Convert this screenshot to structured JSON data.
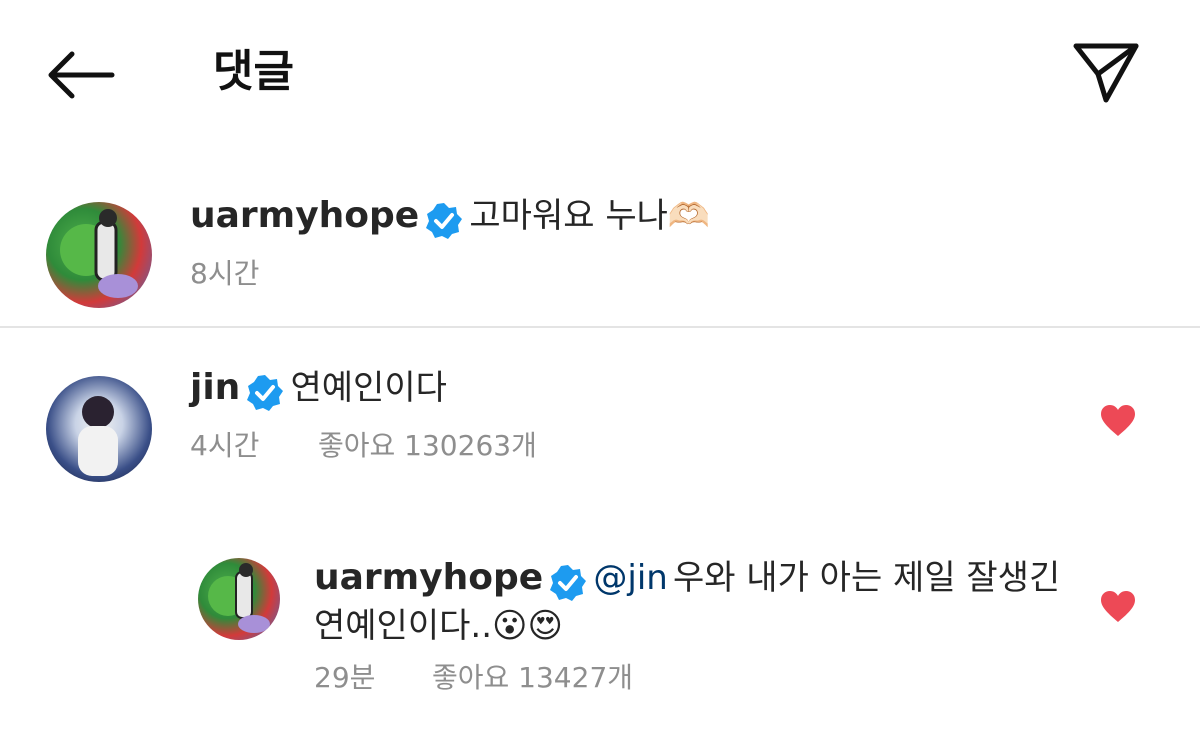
{
  "header": {
    "title": "댓글"
  },
  "comments": [
    {
      "username": "uarmyhope",
      "text": "고마워요 누나🫶🏻",
      "time": "8시간"
    },
    {
      "username": "jin",
      "text": "연예인이다",
      "time": "4시간",
      "likes": "좋아요 130263개",
      "liked": true,
      "reply": {
        "username": "uarmyhope",
        "mention": "@jin",
        "text_line1": "우와 내가 아는 제일 잘생긴",
        "text_line2": "연예인이다..",
        "emojis": "😮😍",
        "time": "29분",
        "likes": "좋아요 13427개",
        "liked": true
      }
    }
  ],
  "colors": {
    "verified": "#1d9bf0",
    "heart": "#ed4956",
    "mention": "#00376b",
    "meta": "#8e8e8e"
  }
}
